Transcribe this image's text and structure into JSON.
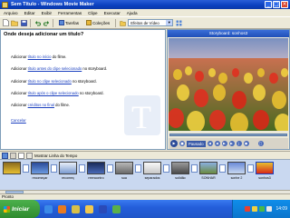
{
  "window": {
    "title": "Sem Título - Windows Movie Maker",
    "minimize": "_",
    "maximize": "□",
    "close": "×"
  },
  "menu": [
    "Arquivo",
    "Editar",
    "Exibir",
    "Ferramentas",
    "Clipe",
    "Executar",
    "Ajuda"
  ],
  "toolbar": {
    "tarefas_label": "Tarefas",
    "colecoes_label": "Coleções",
    "combo_value": "Efeitos de Vídeo"
  },
  "taskpane": {
    "heading": "Onde deseja adicionar um título?",
    "options": [
      {
        "prefix": "Adicionar ",
        "link": "título no início",
        "suffix": " do filme."
      },
      {
        "prefix": "Adicionar ",
        "link": "título antes do clipe selecionado",
        "suffix": " no storyboard."
      },
      {
        "prefix": "Adicionar ",
        "link": "título no clipe selecionado",
        "suffix": " no storyboard."
      },
      {
        "prefix": "Adicionar ",
        "link": "título após o clipe selecionado",
        "suffix": " no storyboard."
      },
      {
        "prefix": "Adicionar ",
        "link": "créditos no final",
        "suffix": " do filme."
      }
    ],
    "cancel": "Cancelar"
  },
  "preview": {
    "title": "Storyboard: sonhos3",
    "status": "Pausado"
  },
  "storyboard": {
    "toggle_label": "Mostrar Linha do Tempo",
    "clips": [
      {
        "caption": "",
        "thumb": "sunflower"
      },
      {
        "caption": "recomeçar",
        "thumb": "blue"
      },
      {
        "caption": "recomeç",
        "thumb": "bluewhite"
      },
      {
        "caption": "reencontro",
        "thumb": "bluedark"
      },
      {
        "caption": "sua",
        "thumb": "gray"
      },
      {
        "caption": "separados",
        "thumb": "white"
      },
      {
        "caption": "solidão",
        "thumb": "road"
      },
      {
        "caption": "SONHAR",
        "thumb": "field"
      },
      {
        "caption": "sonhe 2",
        "thumb": "sky"
      },
      {
        "caption": "sonhos3",
        "thumb": "tulips"
      }
    ]
  },
  "statusbar": "Pronto",
  "taskbar": {
    "start": "Iniciar",
    "clock": "14:09"
  }
}
